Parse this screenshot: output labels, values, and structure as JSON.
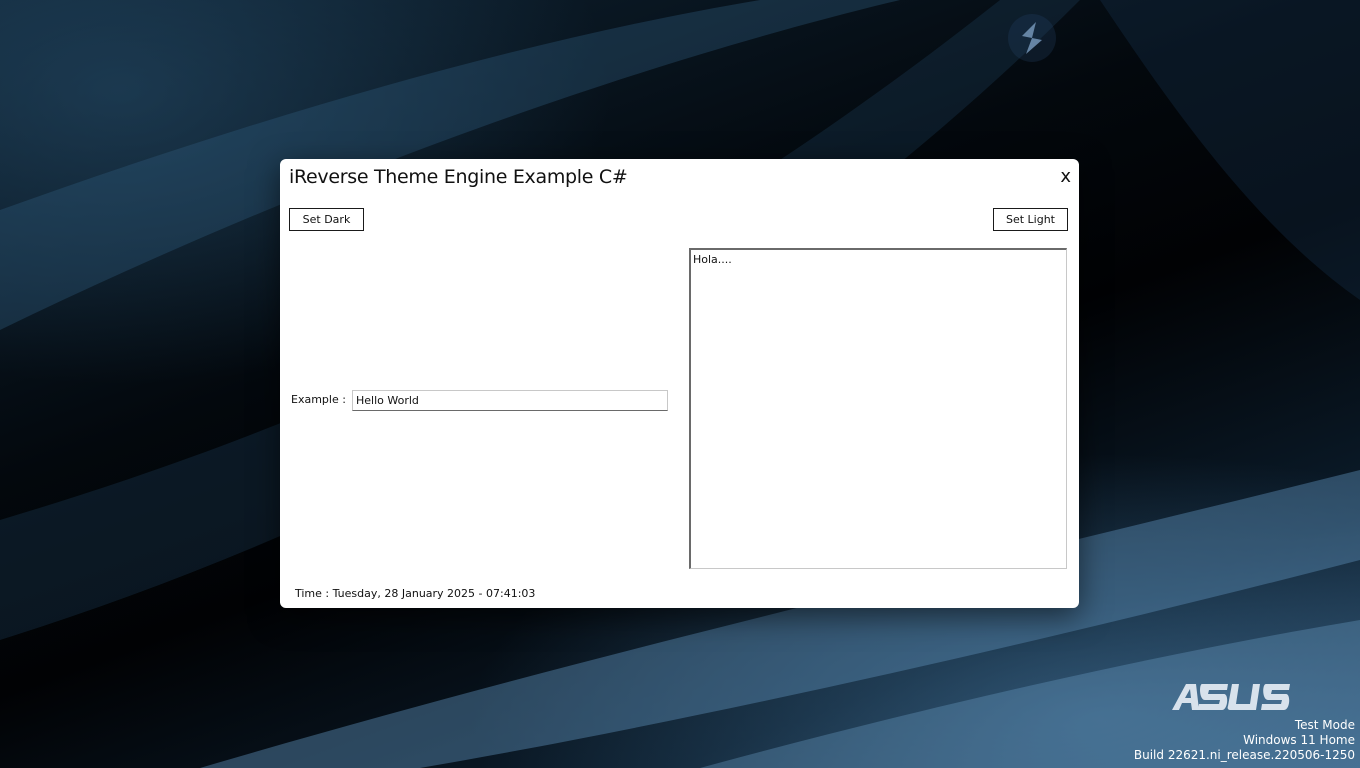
{
  "window": {
    "title": "iReverse Theme Engine Example C#",
    "close_label": "x",
    "set_dark_label": "Set Dark",
    "set_light_label": "Set Light",
    "example_label": "Example :",
    "example_value": "Hello World",
    "textarea_value": "Hola....",
    "time_text": "Time : Tuesday, 28 January 2025 - 07:41:03"
  },
  "desktop": {
    "watermark": {
      "line1": "Test Mode",
      "line2": "Windows 11 Home",
      "line3": "Build 22621.ni_release.220506-1250"
    },
    "brand_logo": "ASUS",
    "icons": [
      "app-logo-icon",
      "asus-logo-icon",
      "close-icon"
    ]
  },
  "colors": {
    "window_bg": "#ffffff",
    "desktop_bg": "#020406",
    "accent_blue": "#2b4a66"
  }
}
